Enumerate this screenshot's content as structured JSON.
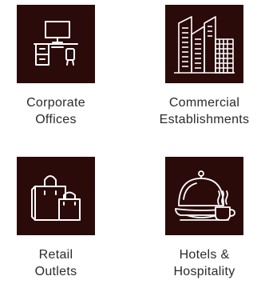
{
  "categories": [
    {
      "icon": "desk-computer-icon",
      "line1": "Corporate",
      "line2": "Offices"
    },
    {
      "icon": "buildings-icon",
      "line1": "Commercial",
      "line2": "Establishments"
    },
    {
      "icon": "shopping-bags-icon",
      "line1": "Retail",
      "line2": "Outlets"
    },
    {
      "icon": "cloche-coffee-icon",
      "line1": "Hotels &",
      "line2": "Hospitality"
    }
  ],
  "colors": {
    "tile_background": "#2b0a0a",
    "icon_stroke": "#ffffff",
    "label_text": "#2a2a2a"
  }
}
